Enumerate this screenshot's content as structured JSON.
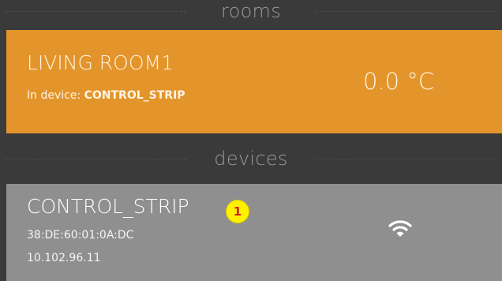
{
  "sections": {
    "rooms_label": "rooms",
    "devices_label": "devices"
  },
  "room": {
    "name": "LIVING ROOM1",
    "device_prefix": "In device: ",
    "device_name": "CONTROL_STRIP",
    "temperature": "0.0 °C",
    "color": "#e3952b"
  },
  "device": {
    "name": "CONTROL_STRIP",
    "mac": "38:DE:60:01:0A:DC",
    "ip": "10.102.96.11",
    "status_icon": "wifi-icon",
    "badge": "1",
    "color": "#8f8f8f"
  }
}
